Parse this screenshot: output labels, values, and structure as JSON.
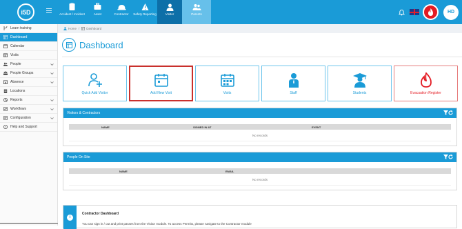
{
  "brand": {
    "logo_text": "i5D",
    "primary": "#1a9bd7",
    "danger": "#e31b23"
  },
  "modules": [
    {
      "label": "Accident / Incident",
      "icon": "clipboard-icon"
    },
    {
      "label": "Asset",
      "icon": "briefcase-icon"
    },
    {
      "label": "Contractor",
      "icon": "hardhat-icon"
    },
    {
      "label": "Safety Reporting",
      "icon": "warning-icon"
    },
    {
      "label": "Visitor",
      "icon": "user-icon"
    },
    {
      "label": "Parents",
      "icon": "people-icon"
    }
  ],
  "user": {
    "initials": "HD"
  },
  "sidebar": {
    "items": [
      {
        "label": "Learn training",
        "icon": "branch-icon"
      },
      {
        "label": "Dashboard",
        "icon": "dashboard-icon",
        "active": true
      },
      {
        "label": "Calendar",
        "icon": "calendar-icon"
      },
      {
        "label": "Visits",
        "icon": "visits-icon"
      },
      {
        "label": "People",
        "icon": "people-icon",
        "expandable": true
      },
      {
        "label": "People Groups",
        "icon": "groups-icon",
        "expandable": true
      },
      {
        "label": "Absence",
        "icon": "absence-icon",
        "expandable": true
      },
      {
        "label": "Locations",
        "icon": "building-icon"
      },
      {
        "label": "Reports",
        "icon": "reports-icon",
        "expandable": true
      },
      {
        "label": "Workflows",
        "icon": "workflow-icon",
        "expandable": true
      },
      {
        "label": "Configuration",
        "icon": "config-icon",
        "expandable": true
      },
      {
        "label": "Help and Support",
        "icon": "help-icon"
      }
    ]
  },
  "breadcrumb": {
    "home": "Home",
    "current": "Dashboard"
  },
  "page": {
    "title": "Dashboard"
  },
  "tiles": [
    {
      "label": "Quick Add Visitor",
      "icon": "add-person-icon"
    },
    {
      "label": "Add New Visit",
      "icon": "calendar-icon"
    },
    {
      "label": "Visits",
      "icon": "calendar-grid-icon"
    },
    {
      "label": "Staff",
      "icon": "staff-icon"
    },
    {
      "label": "Students",
      "icon": "student-icon"
    },
    {
      "label": "Evacuation Register",
      "icon": "fire-icon"
    }
  ],
  "visitors_panel": {
    "title": "Visitors & Contractors",
    "columns": [
      "NAME",
      "SIGNED IN AT",
      "EVENT"
    ],
    "empty_text": "No records"
  },
  "onsite_panel": {
    "title": "People On Site",
    "columns": [
      "NAME",
      "EMAIL"
    ],
    "empty_text": "No records"
  },
  "info_panel": {
    "title": "Contractor Dashboard",
    "text": "You can sign in / out and print passes from the Visitor module. To access Permits, please navigate to the Contractor module"
  }
}
